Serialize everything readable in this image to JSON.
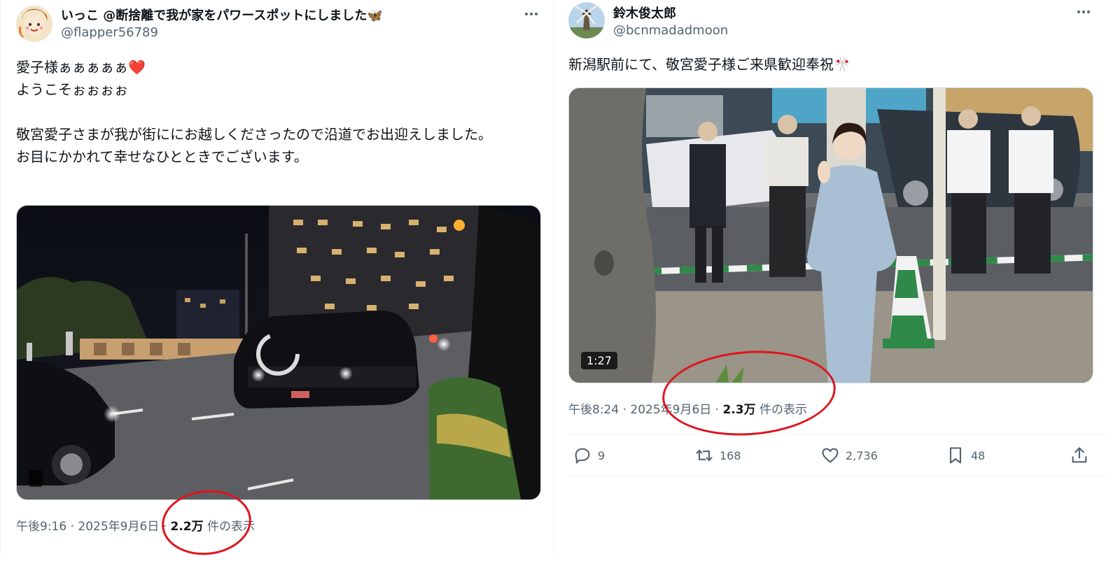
{
  "tweet1": {
    "display_name": "いっこ @断捨離で我が家をパワースポットにしました🦋",
    "handle": "@flapper56789",
    "text": "愛子様ぁぁぁぁぁ❤️\nようこそぉぉぉぉ\n\n敬宮愛子さまが我が街ににお越しくださったので沿道でお出迎えしました。\nお目にかかれて幸せなひとときでございます。",
    "time": "午後9:16 · 2025年9月6日 · ",
    "views": "2.2万",
    "views_suffix": " 件の表示"
  },
  "tweet2": {
    "display_name": "鈴木俊太郎",
    "handle": "@bcnmadadmoon",
    "text": "新潟駅前にて、敬宮愛子様ご来県歓迎奉祝🎌",
    "video_duration": "1:27",
    "time": "午後8:24 · 2025年9月6日 · ",
    "views": "2.3万",
    "views_suffix": " 件の表示",
    "actions": {
      "replies": "9",
      "retweets": "168",
      "likes": "2,736",
      "bookmarks": "48"
    }
  },
  "colors": {
    "annotation_ring": "#e0141e",
    "secondary_text": "#536471",
    "primary_text": "#0f1419"
  }
}
